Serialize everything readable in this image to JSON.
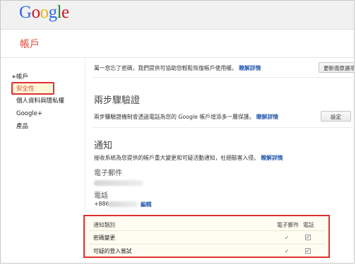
{
  "header": {
    "logo_letters": [
      "G",
      "o",
      "o",
      "g",
      "l",
      "e"
    ],
    "logo_colors": [
      "#3369e8",
      "#d50f25",
      "#eeb211",
      "#3369e8",
      "#009925",
      "#d50f25"
    ],
    "page_title": "帳戶"
  },
  "sidebar": {
    "items": [
      {
        "label": "帳戶",
        "has_arrow": true
      },
      {
        "label": "安全性",
        "active": true
      },
      {
        "label": "個人資料與隱私權"
      },
      {
        "label": "Google+"
      },
      {
        "label": "產品"
      }
    ]
  },
  "recovery": {
    "text": "萬一您忘了密碼，我們提供可協助您輕鬆恢復帳戶使用權。",
    "link": "瞭解詳情",
    "button": "更新復原選項"
  },
  "two_step": {
    "title": "兩步驟驗證",
    "text": "兩步驟驗證機制會透過電話為您的 Google 帳戶增添多一層保護。",
    "link": "瞭解詳情",
    "button": "設定"
  },
  "notifications": {
    "title": "通知",
    "text": "接收系統為您提供的帳戶重大變更和可疑活動通知，杜絕駭客入侵。",
    "link": "瞭解詳情",
    "email_label": "電子郵件",
    "phone_label": "電話",
    "phone_prefix": "+886",
    "edit_link": "編輯",
    "table": {
      "col_category": "通知類別",
      "col_email": "電子郵件",
      "col_phone": "電話",
      "rows": [
        {
          "name": "密碼變更",
          "email": "✓",
          "phone": "✓"
        },
        {
          "name": "可疑的登入嘗試",
          "email": "✓",
          "phone": "✓"
        }
      ]
    }
  }
}
